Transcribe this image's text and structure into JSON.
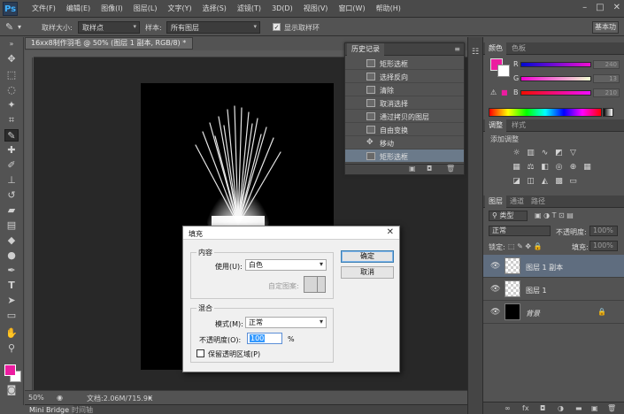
{
  "app": {
    "logo": "Ps",
    "menu": [
      "文件(F)",
      "编辑(E)",
      "图像(I)",
      "图层(L)",
      "文字(Y)",
      "选择(S)",
      "滤镜(T)",
      "3D(D)",
      "视图(V)",
      "窗口(W)",
      "帮助(H)"
    ],
    "window_controls": [
      "–",
      "□",
      "✕"
    ]
  },
  "options_bar": {
    "sample_size_label": "取样大小:",
    "sample_size_value": "取样点",
    "sample_label": "样本:",
    "sample_value": "所有图层",
    "show_ring_label": "显示取样环",
    "workspace": "基本功"
  },
  "document": {
    "tab_title": "16xx8制作羽毛 @ 50% (图层 1 副本, RGB/8) *",
    "zoom": "50%",
    "doc_info": "文档:2.06M/715.9K"
  },
  "bottom_tabs": [
    "Mini Bridge",
    "时间轴"
  ],
  "history": {
    "title": "历史记录",
    "items": [
      "矩形选框",
      "选择反向",
      "清除",
      "取消选择",
      "通过拷贝的图层",
      "自由变换",
      "移动",
      "矩形选框"
    ],
    "selected_index": 7
  },
  "color_panel": {
    "tabs": [
      "颜色",
      "色板"
    ],
    "r_label": "R",
    "g_label": "G",
    "b_label": "B",
    "r_value": "240",
    "g_value": "13",
    "b_value": "210",
    "foreground_color": "#ec1ca0"
  },
  "adjustments_panel": {
    "tabs": [
      "调整",
      "样式"
    ],
    "subtitle": "添加调整"
  },
  "layers_panel": {
    "tabs": [
      "图层",
      "通道",
      "路径"
    ],
    "filter_kind": "类型",
    "blend_mode": "正常",
    "opacity_label": "不透明度:",
    "opacity_value": "100%",
    "lock_label": "锁定:",
    "fill_label": "填充:",
    "fill_value": "100%",
    "layers": [
      {
        "name": "图层 1 副本",
        "selected": true,
        "thumb": "transparent"
      },
      {
        "name": "图层 1",
        "selected": false,
        "thumb": "transparent"
      },
      {
        "name": "背景",
        "selected": false,
        "thumb": "black",
        "locked": true
      }
    ]
  },
  "fill_dialog": {
    "title": "填充",
    "contents_group": "内容",
    "use_label": "使用(U):",
    "use_value": "白色",
    "custom_pattern_label": "自定图案:",
    "ok_label": "确定",
    "cancel_label": "取消",
    "blending_group": "混合",
    "mode_label": "模式(M):",
    "mode_value": "正常",
    "opacity_label": "不透明度(O):",
    "opacity_value": "100",
    "opacity_unit": "%",
    "preserve_label": "保留透明区域(P)"
  }
}
